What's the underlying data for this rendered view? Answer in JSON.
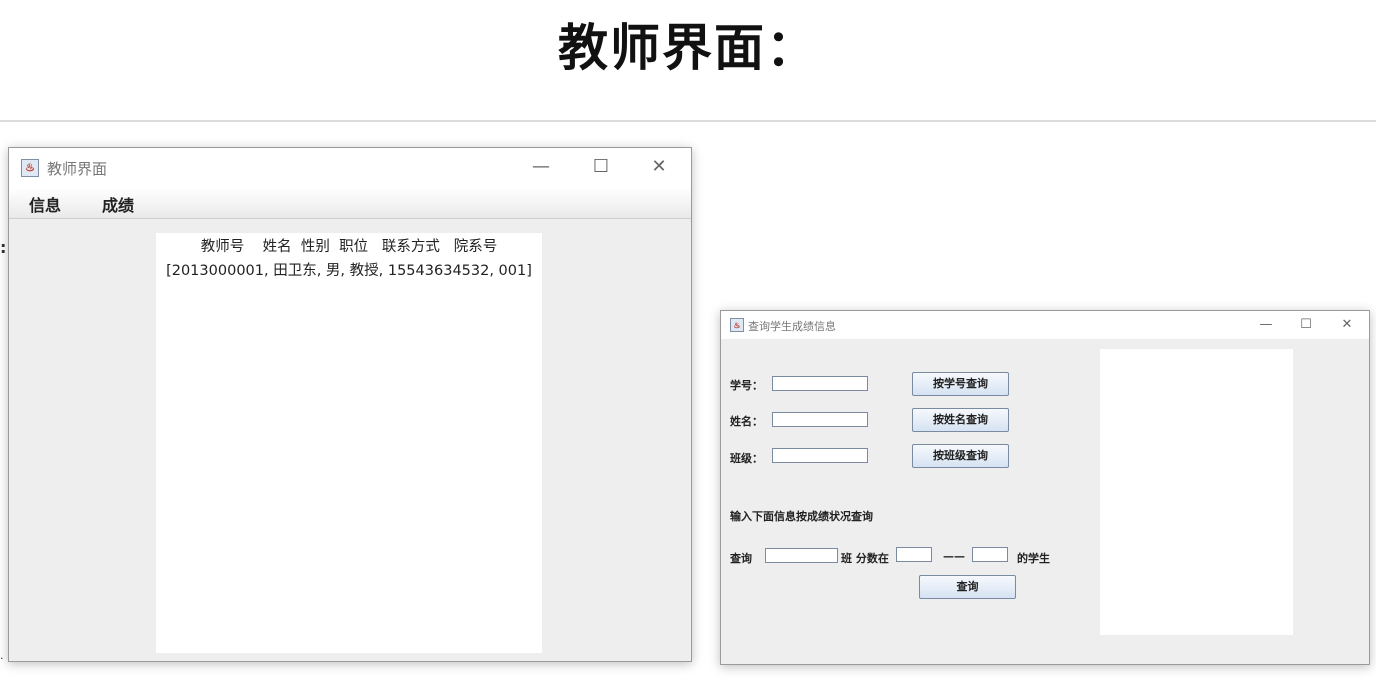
{
  "page": {
    "heading": "教师界面："
  },
  "background": {
    "left_colon": ":",
    "left_bottom_mark": "·"
  },
  "teacher_window": {
    "title": "教师界面",
    "controls": {
      "minimize": "—",
      "maximize": "☐",
      "close": "✕"
    },
    "menu": [
      "信息",
      "成绩"
    ],
    "table": {
      "header": "教师号    姓名  性别  职位   联系方式   院系号",
      "rows": [
        "[2013000001, 田卫东, 男, 教授, 15543634532, 001]"
      ]
    }
  },
  "score_window": {
    "title": "查询学生成绩信息",
    "controls": {
      "minimize": "—",
      "maximize": "☐",
      "close": "✕"
    },
    "fields": [
      {
        "label": "学号：",
        "value": "",
        "button": "按学号查询"
      },
      {
        "label": "姓名：",
        "value": "",
        "button": "按姓名查询"
      },
      {
        "label": "班级：",
        "value": "",
        "button": "按班级查询"
      }
    ],
    "section_label": "输入下面信息按成绩状况查询",
    "range_query": {
      "prefix": "查询",
      "class_value": "",
      "class_suffix": "班 分数在",
      "min_value": "",
      "separator": "——",
      "max_value": "",
      "suffix": "的学生",
      "button": "查询"
    }
  },
  "icons": {
    "app_icon": "java-coffee-icon"
  }
}
